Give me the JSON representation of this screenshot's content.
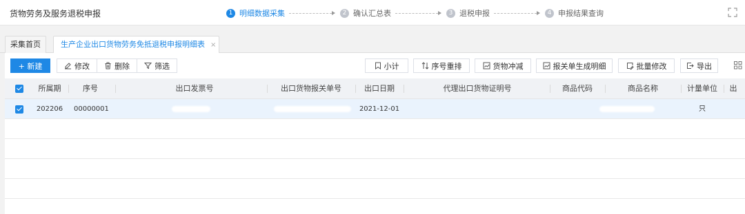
{
  "app": {
    "title": "货物劳务及服务退税申报"
  },
  "steps": [
    {
      "num": "1",
      "label": "明细数据采集",
      "active": true
    },
    {
      "num": "2",
      "label": "确认汇总表",
      "active": false
    },
    {
      "num": "3",
      "label": "退税申报",
      "active": false
    },
    {
      "num": "4",
      "label": "申报结果查询",
      "active": false
    }
  ],
  "tabs": {
    "home": "采集首页",
    "active": "生产企业出口货物劳务免抵退税申报明细表",
    "close": "×"
  },
  "toolbar": {
    "new": "+ 新建",
    "edit": "修改",
    "delete": "删除",
    "filter": "筛选",
    "subtotal": "小计",
    "reorder": "序号重排",
    "offset": "货物冲减",
    "generate": "报关单生成明细",
    "batch_edit": "批量修改",
    "export": "导出"
  },
  "table": {
    "headers": [
      "所属期",
      "序号",
      "出口发票号",
      "出口货物报关单号",
      "出口日期",
      "代理出口货物证明号",
      "商品代码",
      "商品名称",
      "计量单位",
      "出"
    ],
    "rows": [
      {
        "period": "202206",
        "seq": "00000001",
        "invoice": "",
        "customs_no": "",
        "export_date": "2021-12-01",
        "agent_cert": "",
        "product_code": "",
        "product_name": "",
        "unit": "只"
      }
    ]
  },
  "colors": {
    "accent": "#1e88e5",
    "header_bg": "#f0f2f5",
    "selected_row": "#eaf3fd"
  }
}
